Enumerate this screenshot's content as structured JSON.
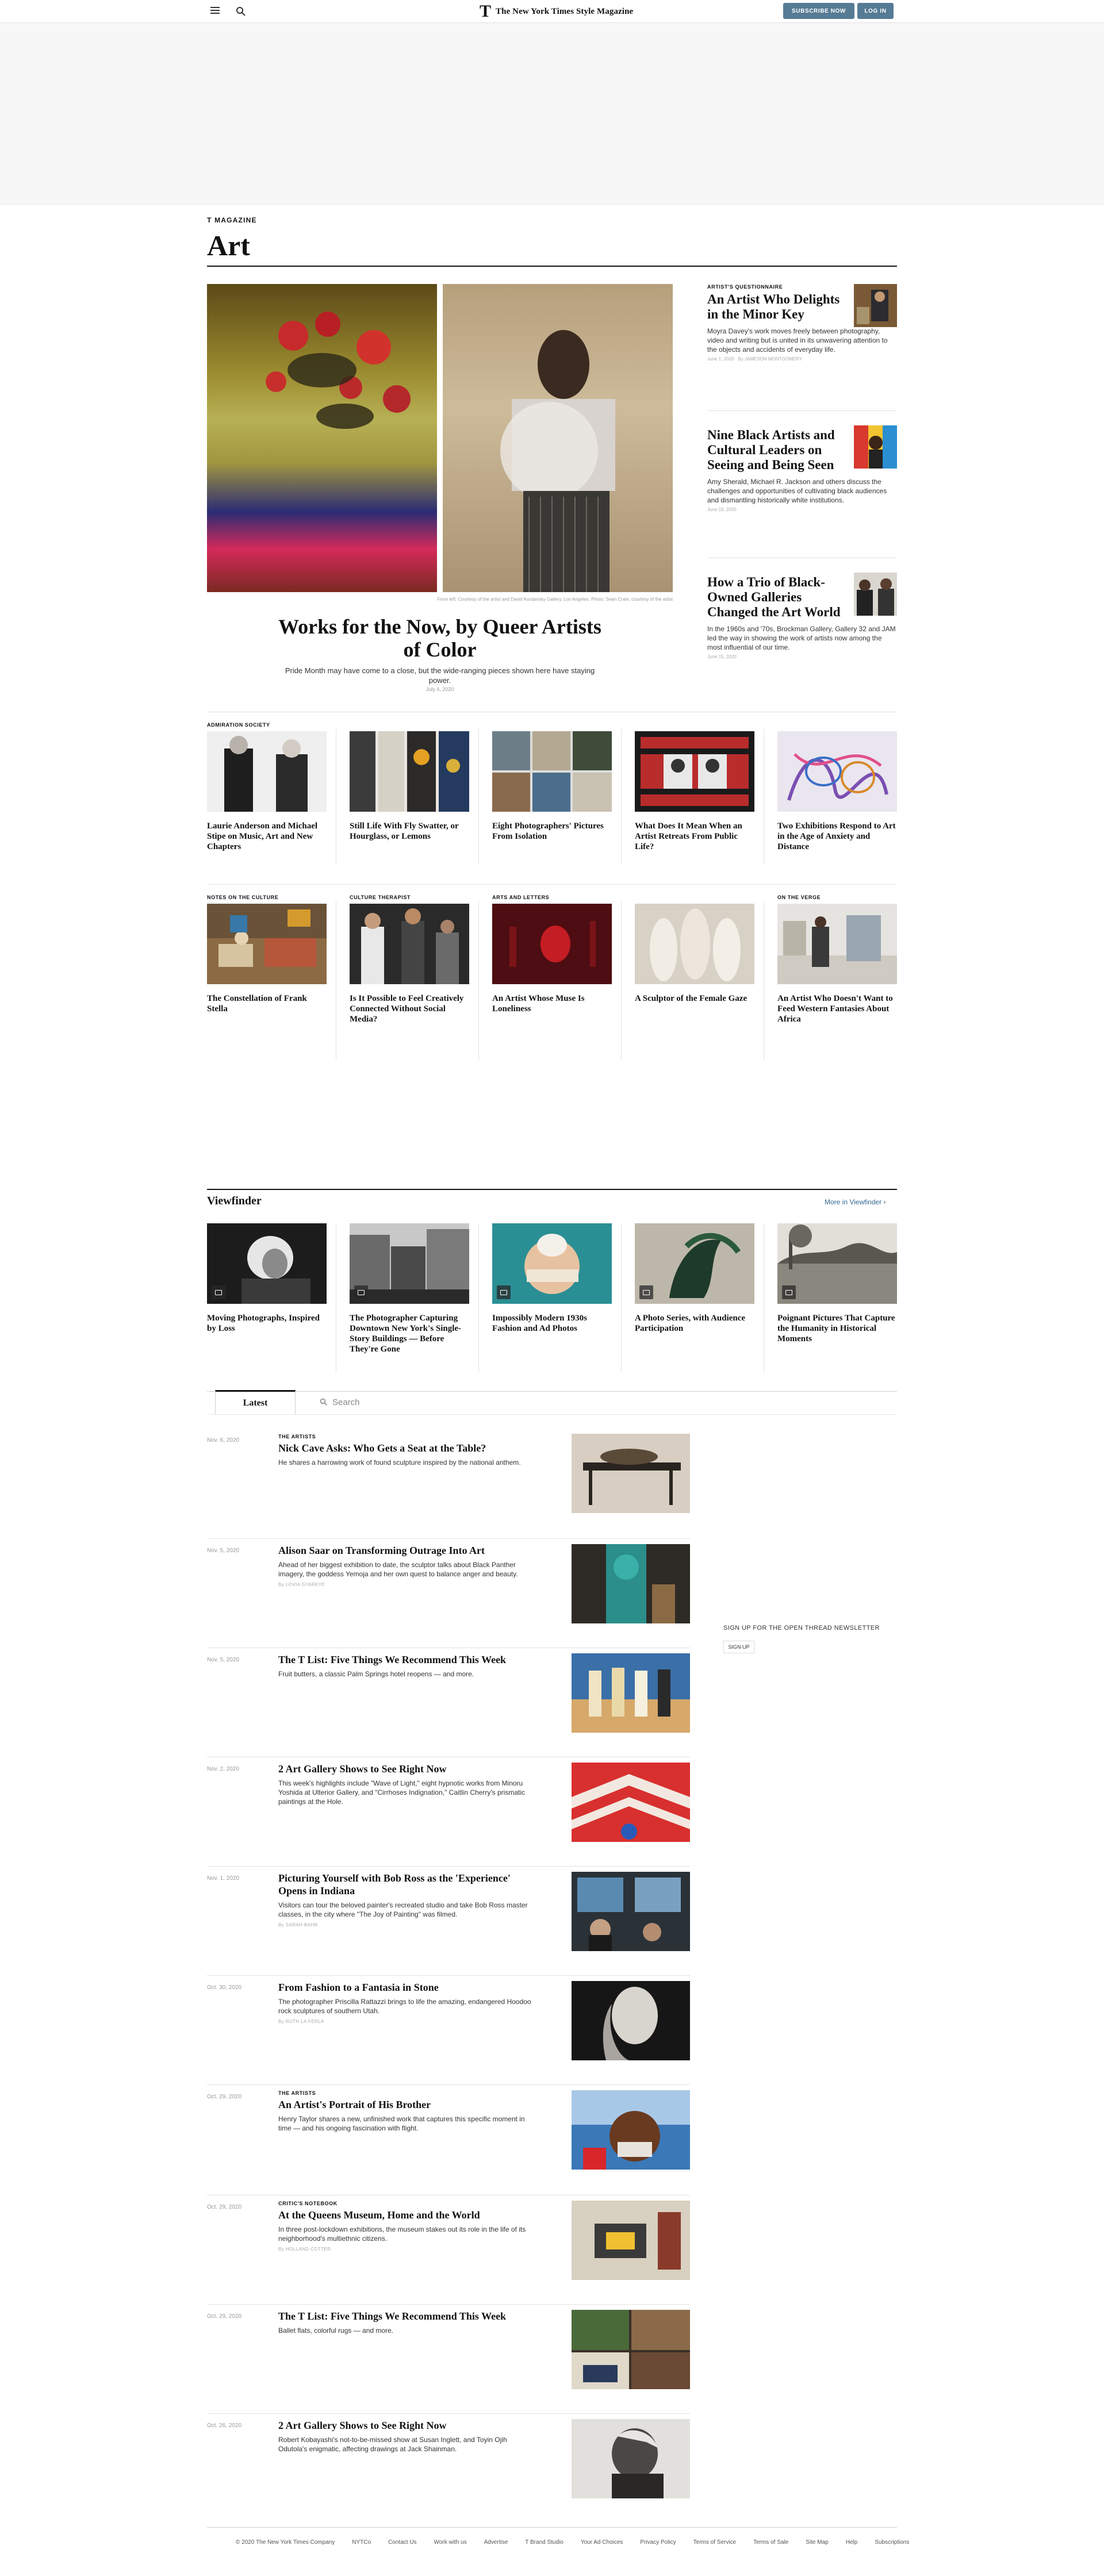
{
  "topbar": {
    "menu_icon": "hamburger-menu-icon",
    "search_icon": "search-icon",
    "brand_t": "T",
    "brand_name": "The New York Times Style Magazine",
    "subscribe": "Subscribe Now",
    "login": "Log In"
  },
  "section": {
    "kicker": "T MAGAZINE",
    "title": "Art"
  },
  "lead": {
    "caption": "From left: Courtesy of the artist and David Kordansky Gallery, Los Angeles. Photo: Sean Crain; courtesy of the artist",
    "title": "Works for the Now, by Queer Artists of Color",
    "summary": "Pride Month may have come to a close, but the wide-ranging pieces shown here have staying power.",
    "date": "July 4, 2020"
  },
  "side": [
    {
      "kicker": "ARTIST'S QUESTIONNAIRE",
      "title": "An Artist Who Delights in the Minor Key",
      "summary": "Moyra Davey's work moves freely between photography, video and writing but is united in its unwavering attention to the objects and accidents of everyday life.",
      "meta": "June 1, 2020 · By JAMESON MONTGOMERY"
    },
    {
      "kicker": "",
      "title": "Nine Black Artists and Cultural Leaders on Seeing and Being Seen",
      "summary": "Amy Sherald, Michael R. Jackson and others discuss the challenges and opportunities of cultivating black audiences and dismantling historically white institutions.",
      "meta": "June 19, 2020"
    },
    {
      "kicker": "",
      "title": "How a Trio of Black-Owned Galleries Changed the Art World",
      "summary": "In the 1960s and '70s, Brockman Gallery, Gallery 32 and JAM led the way in showing the work of artists now among the most influential of our time.",
      "meta": "June 15, 2020"
    }
  ],
  "row1": {
    "kicker": "ADMIRATION SOCIETY",
    "cards": [
      {
        "title": "Laurie Anderson and Michael Stipe on Music, Art and New Chapters"
      },
      {
        "title": "Still Life With Fly Swatter, or Hourglass, or Lemons"
      },
      {
        "title": "Eight Photographers' Pictures From Isolation"
      },
      {
        "title": "What Does It Mean When an Artist Retreats From Public Life?"
      },
      {
        "title": "Two Exhibitions Respond to Art in the Age of Anxiety and Distance"
      }
    ]
  },
  "row2": {
    "cards": [
      {
        "kicker": "NOTES ON THE CULTURE",
        "title": "The Constellation of Frank Stella"
      },
      {
        "kicker": "CULTURE THERAPIST",
        "title": "Is It Possible to Feel Creatively Connected Without Social Media?"
      },
      {
        "kicker": "ARTS AND LETTERS",
        "title": "An Artist Whose Muse Is Loneliness"
      },
      {
        "kicker": "",
        "title": "A Sculptor of the Female Gaze"
      },
      {
        "kicker": "ON THE VERGE",
        "title": "An Artist Who Doesn't Want to Feed Western Fantasies About Africa"
      }
    ]
  },
  "viewfinder": {
    "title": "Viewfinder",
    "more": "More in Viewfinder ›",
    "slideshow_icon": "slideshow-icon",
    "cards": [
      {
        "title": "Moving Photographs, Inspired by Loss"
      },
      {
        "title": "The Photographer Capturing Downtown New York's Single-Story Buildings — Before They're Gone"
      },
      {
        "title": "Impossibly Modern 1930s Fashion and Ad Photos"
      },
      {
        "title": "A Photo Series, with Audience Participation"
      },
      {
        "title": "Poignant Pictures That Capture the Humanity in Historical Moments"
      }
    ]
  },
  "latest": {
    "tab": "Latest",
    "search_placeholder": "Search"
  },
  "stream": [
    {
      "date": "Nov. 6, 2020",
      "kicker": "THE ARTISTS",
      "title": "Nick Cave Asks: Who Gets a Seat at the Table?",
      "summary": "He shares a harrowing work of found sculpture inspired by the national anthem.",
      "byline": ""
    },
    {
      "date": "Nov. 5, 2020",
      "kicker": "",
      "title": "Alison Saar on Transforming Outrage Into Art",
      "summary": "Ahead of her biggest exhibition to date, the sculptor talks about Black Panther imagery, the goddess Yemoja and her own quest to balance anger and beauty.",
      "byline": "By LOVIA GYARKYE"
    },
    {
      "date": "Nov. 5, 2020",
      "kicker": "",
      "title": "The T List: Five Things We Recommend This Week",
      "summary": "Fruit butters, a classic Palm Springs hotel reopens — and more.",
      "byline": ""
    },
    {
      "date": "Nov. 2, 2020",
      "kicker": "",
      "title": "2 Art Gallery Shows to See Right Now",
      "summary": "This week's highlights include \"Wave of Light,\" eight hypnotic works from Minoru Yoshida at Ulterior Gallery, and \"Cirrhoses Indignation,\" Caitlin Cherry's prismatic paintings at the Hole.",
      "byline": ""
    },
    {
      "date": "Nov. 1, 2020",
      "kicker": "",
      "title": "Picturing Yourself with Bob Ross as the 'Experience' Opens in Indiana",
      "summary": "Visitors can tour the beloved painter's recreated studio and take Bob Ross master classes, in the city where \"The Joy of Painting\" was filmed.",
      "byline": "By SARAH BAHR"
    },
    {
      "date": "Oct. 30, 2020",
      "kicker": "",
      "title": "From Fashion to a Fantasia in Stone",
      "summary": "The photographer Priscilla Rattazzi brings to life the amazing, endangered Hoodoo rock sculptures of southern Utah.",
      "byline": "By RUTH LA FERLA"
    },
    {
      "date": "Oct. 29, 2020",
      "kicker": "THE ARTISTS",
      "title": "An Artist's Portrait of His Brother",
      "summary": "Henry Taylor shares a new, unfinished work that captures this specific moment in time — and his ongoing fascination with flight.",
      "byline": ""
    },
    {
      "date": "Oct. 29, 2020",
      "kicker": "CRITIC'S NOTEBOOK",
      "title": "At the Queens Museum, Home and the World",
      "summary": "In three post-lockdown exhibitions, the museum stakes out its role in the life of its neighborhood's multiethnic citizens.",
      "byline": "By HOLLAND COTTER"
    },
    {
      "date": "Oct. 29, 2020",
      "kicker": "",
      "title": "The T List: Five Things We Recommend This Week",
      "summary": "Ballet flats, colorful rugs — and more.",
      "byline": ""
    },
    {
      "date": "Oct. 26, 2020",
      "kicker": "",
      "title": "2 Art Gallery Shows to See Right Now",
      "summary": "Robert Kobayashi's not-to-be-missed show at Susan Inglett, and Toyin Ojih Odutola's enigmatic, affecting drawings at Jack Shainman.",
      "byline": ""
    }
  ],
  "newsletter": {
    "label": "SIGN UP FOR THE OPEN THREAD NEWSLETTER",
    "button": "SIGN UP"
  },
  "footer": {
    "links": [
      "© 2020 The New York Times Company",
      "NYTCo",
      "Contact Us",
      "Work with us",
      "Advertise",
      "T Brand Studio",
      "Your Ad Choices",
      "Privacy Policy",
      "Terms of Service",
      "Terms of Sale",
      "Site Map",
      "Help",
      "Subscriptions"
    ]
  }
}
